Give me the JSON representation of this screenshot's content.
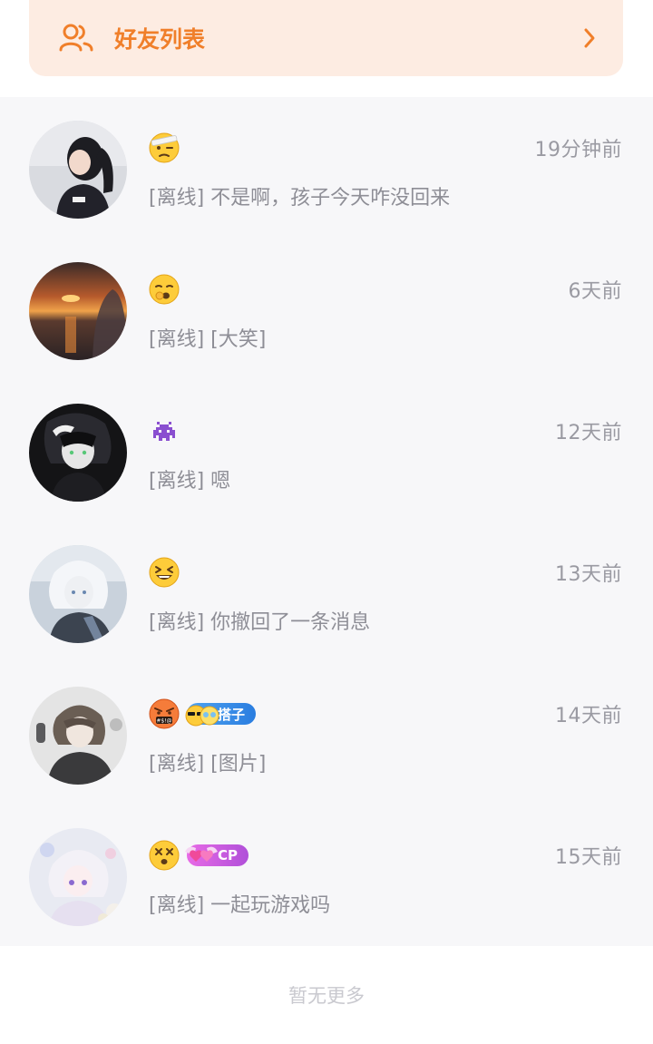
{
  "friends_banner": {
    "label": "好友列表",
    "icon": "friends-icon",
    "chevron": "chevron-right-icon",
    "color": "#f07f2a"
  },
  "chats": [
    {
      "status_emoji": "bandage-face-emoji",
      "badge": null,
      "time": "19分钟前",
      "preview": "[离线] 不是啊，孩子今天咋没回来"
    },
    {
      "status_emoji": "yawning-face-emoji",
      "badge": null,
      "time": "6天前",
      "preview": "[离线] [大笑]"
    },
    {
      "status_emoji": "space-invader-emoji",
      "badge": null,
      "time": "12天前",
      "preview": "[离线] 嗯"
    },
    {
      "status_emoji": "grinning-squinting-emoji",
      "badge": null,
      "time": "13天前",
      "preview": "[离线] 你撤回了一条消息"
    },
    {
      "status_emoji": "cursing-face-emoji",
      "badge": {
        "label": "搭子",
        "color": "#2a7de0"
      },
      "time": "14天前",
      "preview": "[离线] [图片]"
    },
    {
      "status_emoji": "dizzy-face-emoji",
      "badge": {
        "label": "CP",
        "color": "#b04fd9"
      },
      "time": "15天前",
      "preview": "[离线] 一起玩游戏吗"
    }
  ],
  "footer": {
    "text": "暂无更多"
  }
}
